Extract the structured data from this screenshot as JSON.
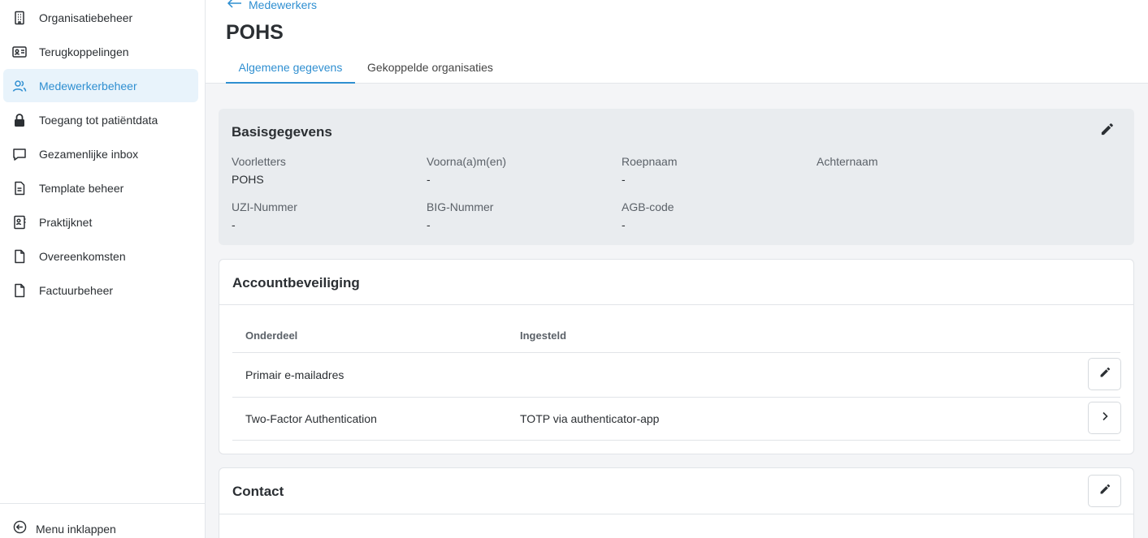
{
  "sidebar": {
    "items": [
      {
        "label": "Organisatiebeheer",
        "icon": "building-icon"
      },
      {
        "label": "Terugkoppelingen",
        "icon": "id-card-icon"
      },
      {
        "label": "Medewerkerbeheer",
        "icon": "users-icon",
        "active": true
      },
      {
        "label": "Toegang tot patiëntdata",
        "icon": "lock-icon"
      },
      {
        "label": "Gezamenlijke inbox",
        "icon": "chat-icon"
      },
      {
        "label": "Template beheer",
        "icon": "document-icon"
      },
      {
        "label": "Praktijknet",
        "icon": "contact-book-icon"
      },
      {
        "label": "Overeenkomsten",
        "icon": "file-icon"
      },
      {
        "label": "Factuurbeheer",
        "icon": "file-icon"
      }
    ],
    "collapse_label": "Menu inklappen"
  },
  "header": {
    "back_label": "Medewerkers",
    "title": "POHS",
    "tabs": [
      {
        "label": "Algemene gegevens",
        "active": true
      },
      {
        "label": "Gekoppelde organisaties",
        "active": false
      }
    ]
  },
  "basisgegevens": {
    "title": "Basisgegevens",
    "fields": [
      {
        "label": "Voorletters",
        "value": "POHS"
      },
      {
        "label": "Voorna(a)m(en)",
        "value": "-"
      },
      {
        "label": "Roepnaam",
        "value": "-"
      },
      {
        "label": "Achternaam",
        "value": ""
      },
      {
        "label": "UZI-Nummer",
        "value": "-"
      },
      {
        "label": "BIG-Nummer",
        "value": "-"
      },
      {
        "label": "AGB-code",
        "value": "-"
      }
    ]
  },
  "accountbeveiliging": {
    "title": "Accountbeveiliging",
    "columns": [
      "Onderdeel",
      "Ingesteld"
    ],
    "rows": [
      {
        "onderdeel": "Primair e-mailadres",
        "ingesteld": "",
        "action": "edit-icon"
      },
      {
        "onderdeel": "Two-Factor Authentication",
        "ingesteld": "TOTP via authenticator-app",
        "action": "chevron-right-icon"
      }
    ]
  },
  "contact": {
    "title": "Contact"
  },
  "colors": {
    "accent": "#2f8fd1",
    "active_bg": "#e8f3fb",
    "card_grey": "#e9ecef",
    "page_bg": "#f4f5f7"
  }
}
